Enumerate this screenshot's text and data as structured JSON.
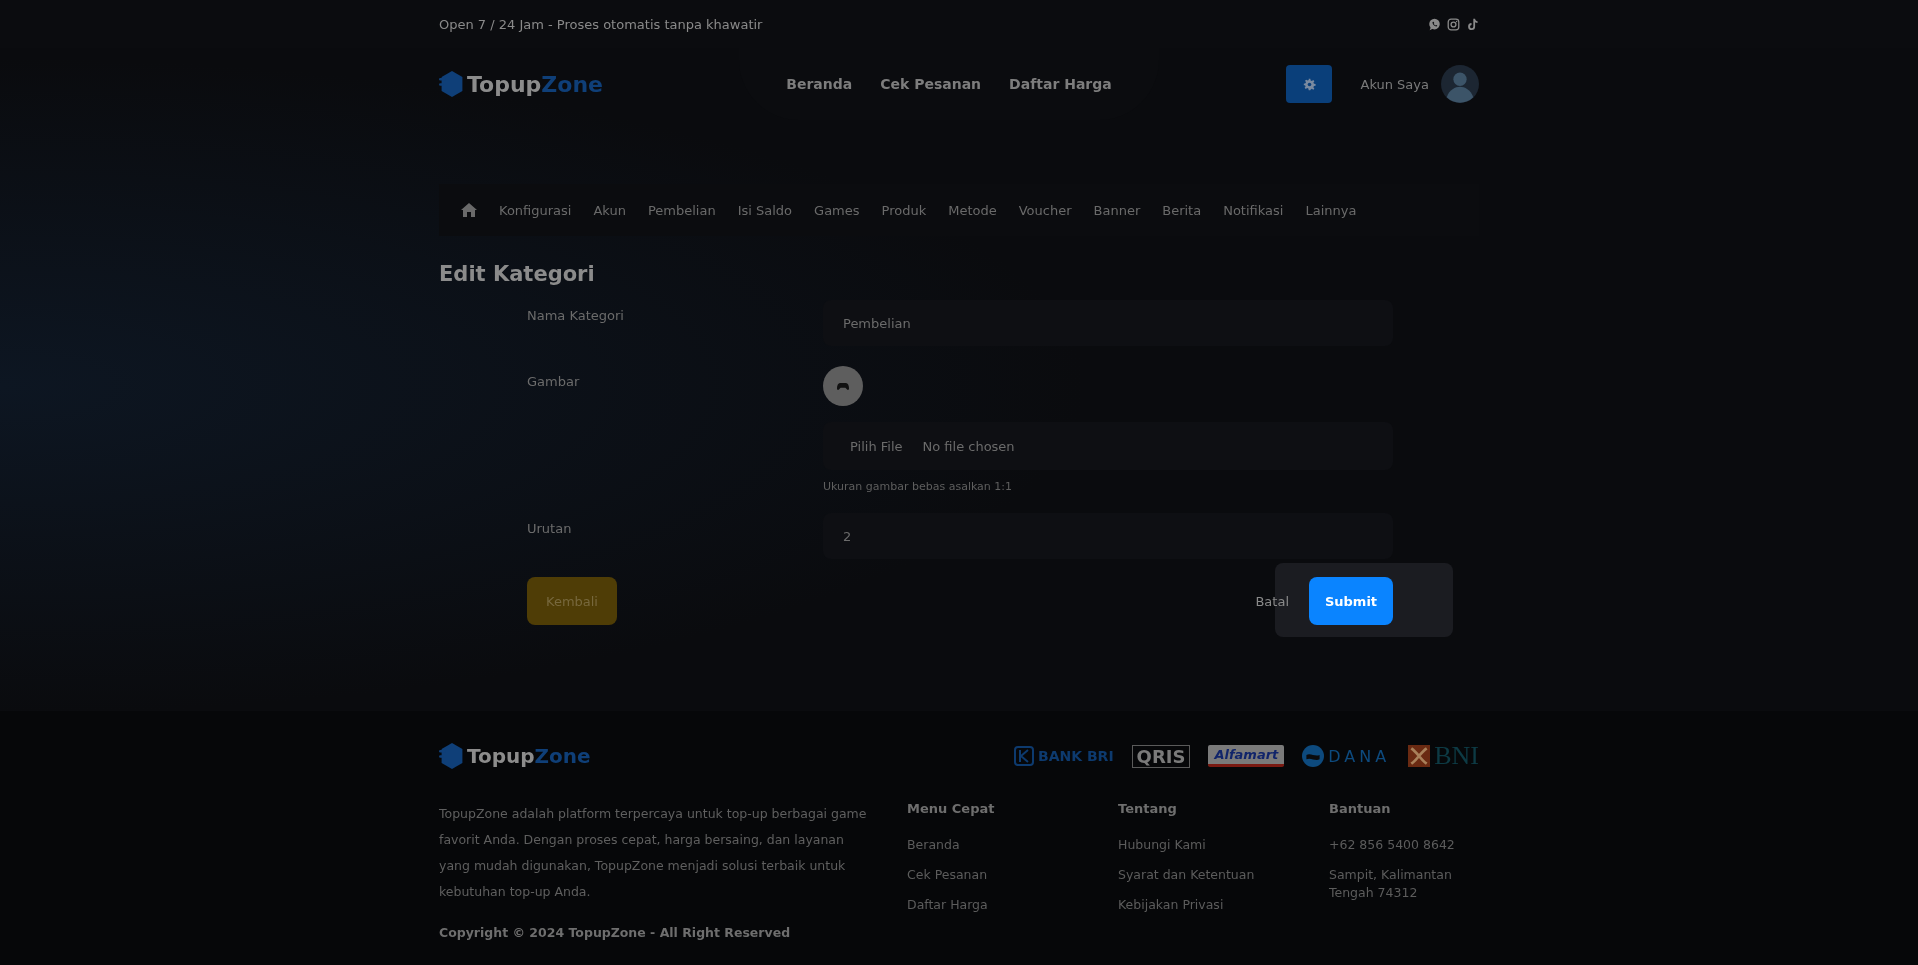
{
  "top_bar": {
    "text": "Open 7 / 24 Jam - Proses otomatis tanpa khawatir",
    "social": [
      {
        "kind": "whatsapp"
      },
      {
        "kind": "instagram"
      },
      {
        "kind": "tiktok"
      }
    ]
  },
  "header": {
    "logo": {
      "first": "Topup",
      "second": "Zone"
    },
    "nav": [
      "Beranda",
      "Cek Pesanan",
      "Daftar Harga"
    ],
    "account": "Akun Saya"
  },
  "admin_menu": [
    "Konfigurasi",
    "Akun",
    "Pembelian",
    "Isi Saldo",
    "Games",
    "Produk",
    "Metode",
    "Voucher",
    "Banner",
    "Berita",
    "Notifikasi",
    "Lainnya"
  ],
  "form": {
    "title": "Edit Kategori",
    "name": {
      "label": "Nama Kategori",
      "value": "Pembelian"
    },
    "image": {
      "label": "Gambar",
      "button": "Pilih File",
      "file": "No file chosen",
      "hint": "Ukuran gambar bebas asalkan 1:1"
    },
    "order": {
      "label": "Urutan",
      "value": "2"
    },
    "back": "Kembali"
  },
  "dialog": {
    "cancel": "Batal",
    "submit": "Submit"
  },
  "footer": {
    "logo": {
      "first": "Topup",
      "second": "Zone"
    },
    "payments": [
      {
        "kind": "bri",
        "text": "BANK BRI"
      },
      {
        "kind": "qris",
        "text": "QRIS"
      },
      {
        "kind": "alfamart",
        "text": "Alfamart"
      },
      {
        "kind": "dana",
        "text": "DANA"
      },
      {
        "kind": "bni",
        "text": "BNI"
      }
    ],
    "about": "TopupZone adalah platform terpercaya untuk top-up berbagai game favorit Anda. Dengan proses cepat, harga bersaing, dan layanan yang mudah digunakan, TopupZone menjadi solusi terbaik untuk kebutuhan top-up Anda.",
    "copyright": "Copyright © 2024 TopupZone - All Right Reserved",
    "columns": [
      {
        "title": "Menu Cepat",
        "links": [
          "Beranda",
          "Cek Pesanan",
          "Daftar Harga"
        ]
      },
      {
        "title": "Tentang",
        "links": [
          "Hubungi Kami",
          "Syarat dan Ketentuan",
          "Kebijakan Privasi"
        ]
      },
      {
        "title": "Bantuan",
        "links": [
          "+62 856 5400 8642",
          "Sampit, Kalimantan Tengah 74312"
        ]
      }
    ]
  }
}
